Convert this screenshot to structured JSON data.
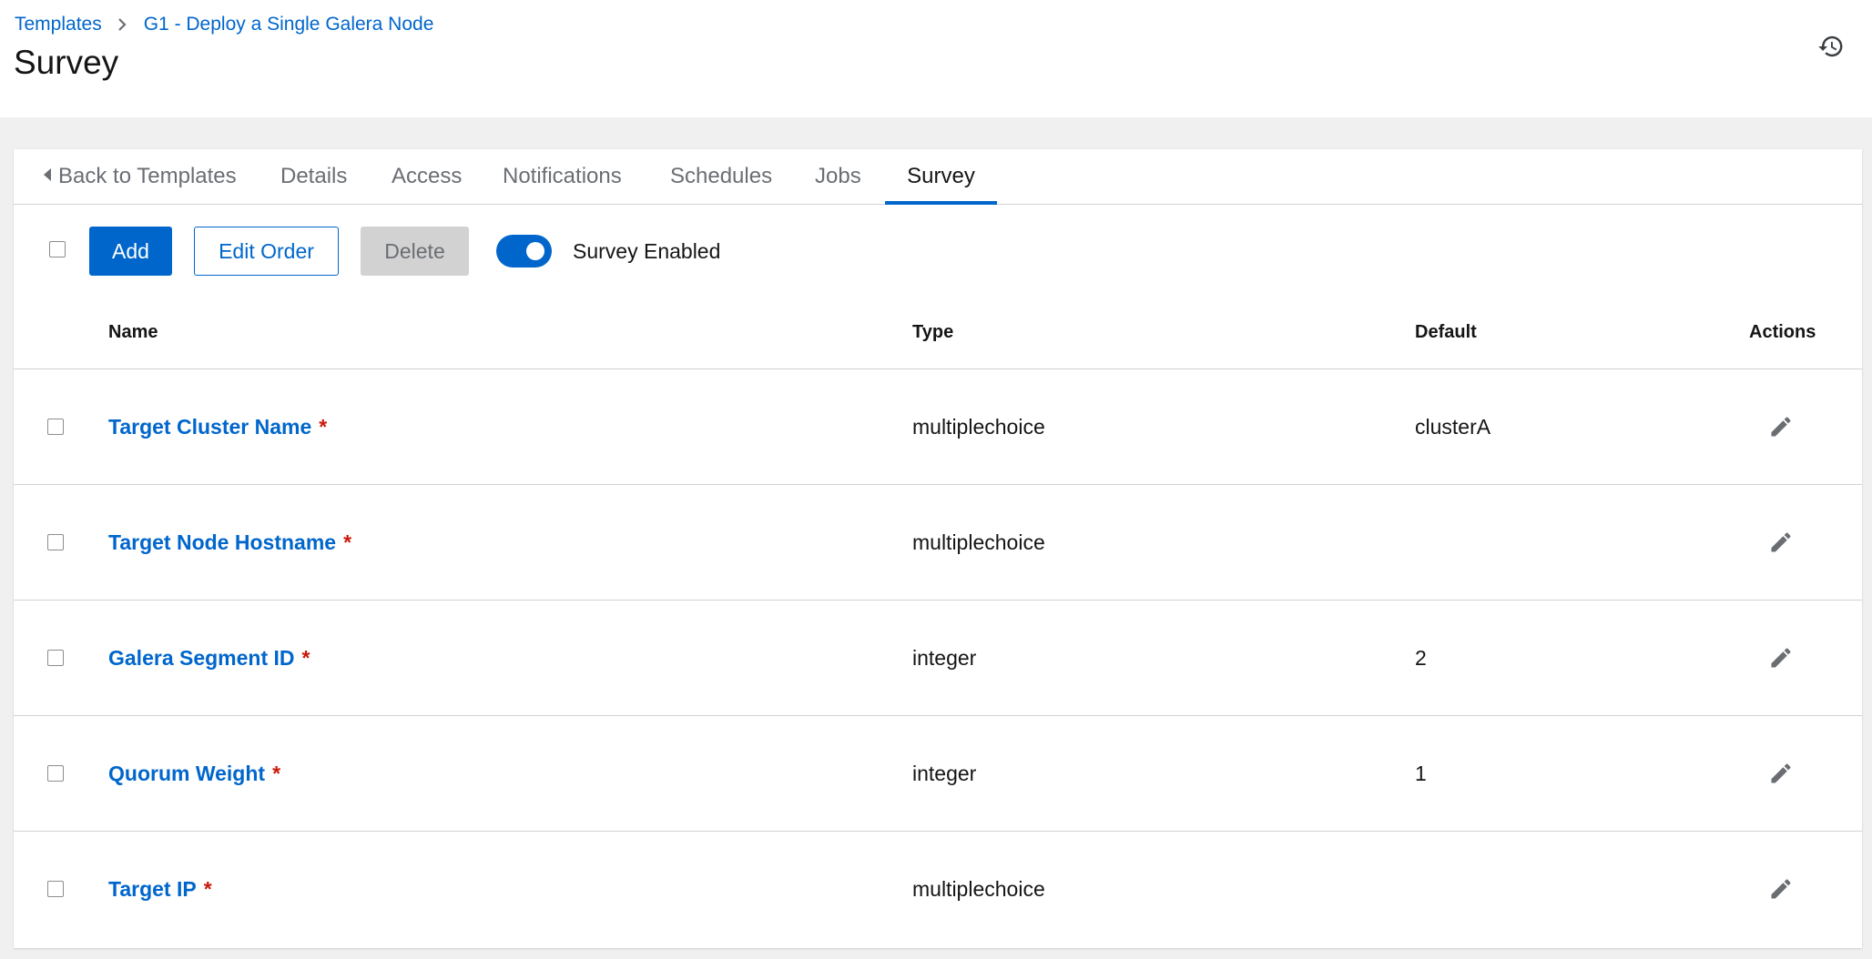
{
  "breadcrumb": {
    "items": [
      {
        "label": "Templates"
      },
      {
        "label": "G1 - Deploy a Single Galera Node"
      }
    ]
  },
  "page": {
    "title": "Survey"
  },
  "icons": {
    "history": "history-icon",
    "edit": "pencil-icon",
    "breadcrumb_sep": "chevron-right-icon",
    "back": "caret-left-icon"
  },
  "tabs": [
    {
      "label": "Back to Templates"
    },
    {
      "label": "Details"
    },
    {
      "label": "Access"
    },
    {
      "label": "Notifications"
    },
    {
      "label": "Schedules"
    },
    {
      "label": "Jobs"
    },
    {
      "label": "Survey",
      "active": true
    }
  ],
  "toolbar": {
    "add_label": "Add",
    "edit_order_label": "Edit Order",
    "delete_label": "Delete",
    "survey_enabled_label": "Survey Enabled",
    "survey_enabled": true
  },
  "table": {
    "columns": {
      "name": "Name",
      "type": "Type",
      "default": "Default",
      "actions": "Actions"
    },
    "rows": [
      {
        "name": "Target Cluster Name",
        "required_mark": "*",
        "type": "multiplechoice",
        "default": "clusterA"
      },
      {
        "name": "Target Node Hostname",
        "required_mark": "*",
        "type": "multiplechoice",
        "default": ""
      },
      {
        "name": "Galera Segment ID",
        "required_mark": "*",
        "type": "integer",
        "default": "2"
      },
      {
        "name": "Quorum Weight",
        "required_mark": "*",
        "type": "integer",
        "default": "1"
      },
      {
        "name": "Target IP",
        "required_mark": "*",
        "type": "multiplechoice",
        "default": ""
      }
    ]
  },
  "colors": {
    "accent": "#0066cc",
    "required": "#c9190b",
    "disabled_bg": "#d2d2d2",
    "page_bg": "#f0f0f0"
  }
}
